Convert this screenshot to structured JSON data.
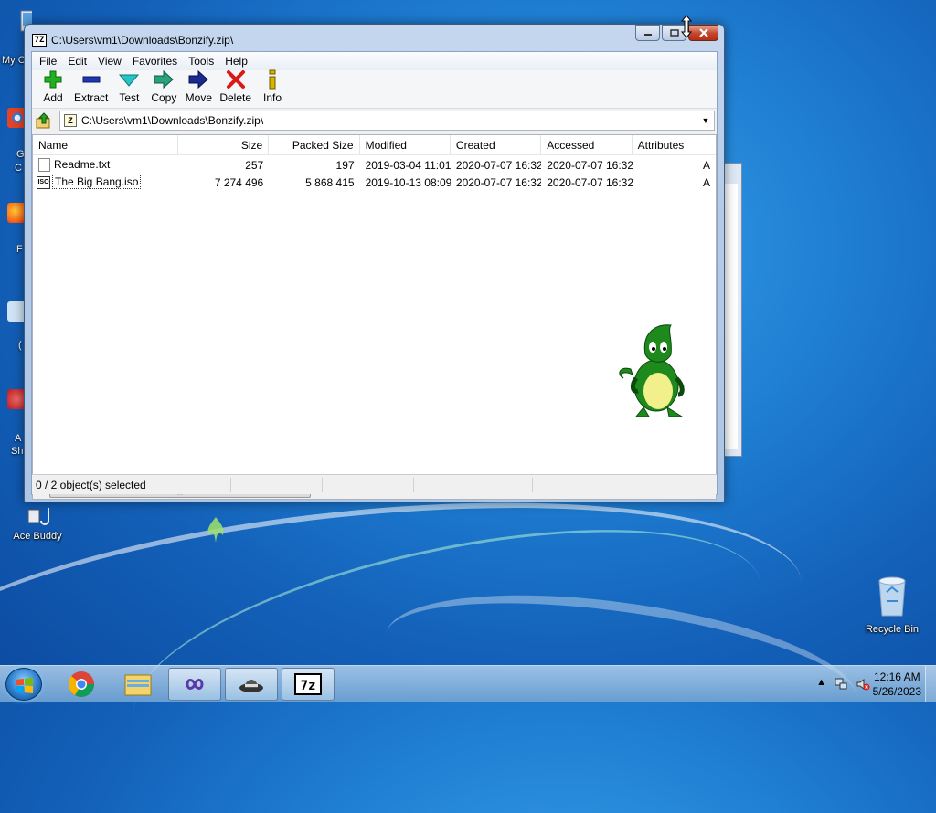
{
  "window": {
    "title": "C:\\Users\\vm1\\Downloads\\Bonzify.zip\\",
    "app_icon_text": "7Z"
  },
  "menu": [
    "File",
    "Edit",
    "View",
    "Favorites",
    "Tools",
    "Help"
  ],
  "toolbar": [
    {
      "label": "Add",
      "icon": "plus-icon",
      "color": "#1aa01a"
    },
    {
      "label": "Extract",
      "icon": "minus-icon",
      "color": "#1a2fa0"
    },
    {
      "label": "Test",
      "icon": "check-arrow-icon",
      "color": "#20b4b4"
    },
    {
      "label": "Copy",
      "icon": "arrow-right-icon",
      "color": "#2a9a7a"
    },
    {
      "label": "Move",
      "icon": "arrow-right-icon",
      "color": "#1a2a8a"
    },
    {
      "label": "Delete",
      "icon": "x-icon",
      "color": "#d81a1a"
    },
    {
      "label": "Info",
      "icon": "info-icon",
      "color": "#c8a800"
    }
  ],
  "address": {
    "value": "C:\\Users\\vm1\\Downloads\\Bonzify.zip\\"
  },
  "columns": [
    "Name",
    "Size",
    "Packed Size",
    "Modified",
    "Created",
    "Accessed",
    "Attributes"
  ],
  "files": [
    {
      "name": "Readme.txt",
      "size": "257",
      "packed": "197",
      "modified": "2019-03-04 11:01",
      "created": "2020-07-07 16:32",
      "accessed": "2020-07-07 16:32",
      "attr": "A",
      "icon": "text-file-icon"
    },
    {
      "name": "The Big Bang.iso",
      "size": "7 274 496",
      "packed": "5 868 415",
      "modified": "2019-10-13 08:09",
      "created": "2020-07-07 16:32",
      "accessed": "2020-07-07 16:32",
      "attr": "A",
      "icon": "iso-file-icon"
    }
  ],
  "status": {
    "selection": "0 / 2 object(s) selected"
  },
  "scrollbar_grip": "|||",
  "desktop": {
    "top_left_label": "My C",
    "ace_buddy": "Ace Buddy",
    "recycle_bin": "Recycle Bin",
    "edge_labels": [
      "G",
      "C",
      "F",
      "(",
      "A",
      "Sh"
    ]
  },
  "taskbar": {
    "time": "12:16 AM",
    "date": "5/26/2023"
  },
  "colors": {
    "desktop": "#1f7fd3",
    "dragon": "#1e8a1e"
  }
}
